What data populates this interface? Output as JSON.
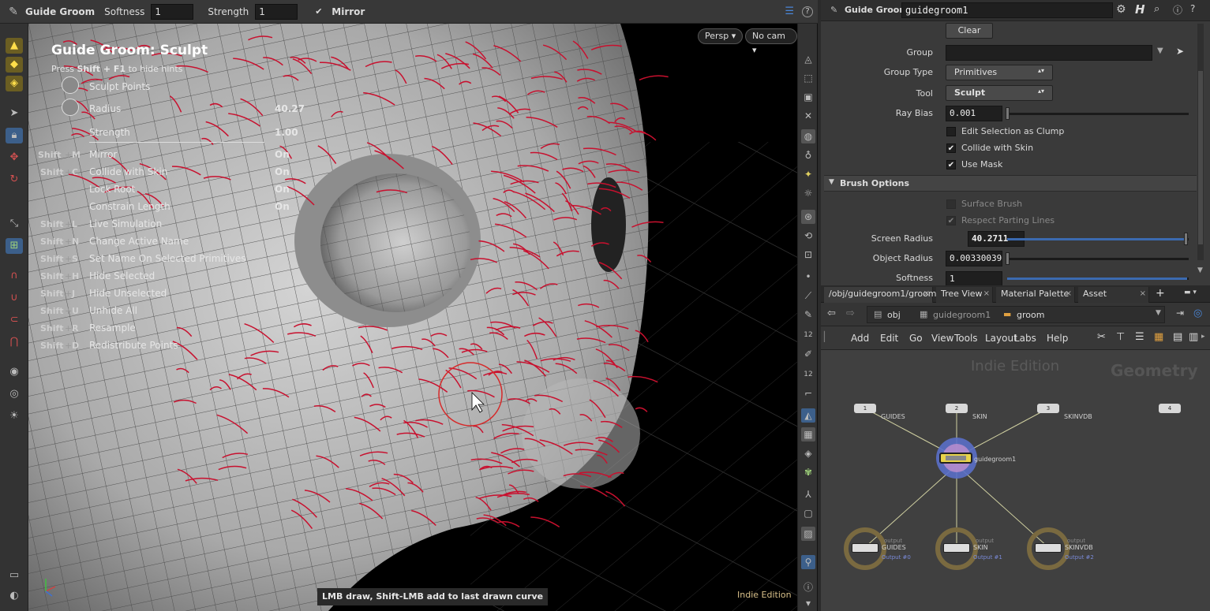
{
  "viewport_toolbar": {
    "tool_name": "Guide Groom",
    "softness_label": "Softness",
    "softness_value": "1",
    "strength_label": "Strength",
    "strength_value": "1",
    "mirror_label": "Mirror"
  },
  "viewport": {
    "hud_title": "Guide Groom: Sculpt",
    "hint_prefix": "Press ",
    "hint_keys": "Shift + F1",
    "hint_suffix": " to hide hints",
    "camera_persp": "Persp",
    "camera_nocam": "No cam",
    "status_message": "LMB draw, Shift-LMB add to last drawn curve",
    "edition_badge": "Indie Edition",
    "hud_top": [
      {
        "label": "Sculpt Points",
        "value": ""
      },
      {
        "label": "Radius",
        "value": "40.27"
      },
      {
        "label": "Strength",
        "value": "1.00"
      }
    ],
    "hotkeys": [
      {
        "mod": "Shift",
        "key": "M",
        "label": "Mirror",
        "value": "On"
      },
      {
        "mod": "Shift",
        "key": "C",
        "label": "Collide with Skin",
        "value": "On"
      },
      {
        "mod": "",
        "key": "",
        "label": "Lock Root",
        "value": "On"
      },
      {
        "mod": "",
        "key": "",
        "label": "Constrain Length",
        "value": "On"
      },
      {
        "mod": "Shift",
        "key": "L",
        "label": "Live Simulation",
        "value": ""
      },
      {
        "mod": "Shift",
        "key": "N",
        "label": "Change Active Name",
        "value": ""
      },
      {
        "mod": "Shift",
        "key": "S",
        "label": "Set Name On Selected Primitives",
        "value": ""
      },
      {
        "mod": "Shift",
        "key": "H",
        "label": "Hide Selected",
        "value": ""
      },
      {
        "mod": "Shift",
        "key": "J",
        "label": "Hide Unselected",
        "value": ""
      },
      {
        "mod": "Shift",
        "key": "U",
        "label": "Unhide All",
        "value": ""
      },
      {
        "mod": "Shift",
        "key": "R",
        "label": "Resample",
        "value": ""
      },
      {
        "mod": "Shift",
        "key": "D",
        "label": "Redistribute Points",
        "value": ""
      }
    ]
  },
  "params": {
    "node_type": "Guide Groom",
    "node_name": "guidegroom1",
    "clear_label": "Clear",
    "group_label": "Group",
    "group_value": "",
    "group_type_label": "Group Type",
    "group_type_value": "Primitives",
    "tool_label": "Tool",
    "tool_value": "Sculpt",
    "ray_bias_label": "Ray Bias",
    "ray_bias_value": "0.001",
    "edit_selection_label": "Edit Selection as Clump",
    "collide_label": "Collide with Skin",
    "use_mask_label": "Use Mask",
    "brush_section": "Brush Options",
    "surface_brush_label": "Surface Brush",
    "respect_parting_label": "Respect Parting Lines",
    "screen_radius_label": "Screen Radius",
    "screen_radius_value": "40.2711",
    "object_radius_label": "Object Radius",
    "object_radius_value": "0.00330039",
    "softness_label": "Softness",
    "softness_value": "1"
  },
  "network": {
    "tabs": [
      "/obj/guidegroom1/groom",
      "Tree View",
      "Material Palette",
      "Asset Browser"
    ],
    "path": [
      "obj",
      "guidegroom1",
      "groom"
    ],
    "menu": [
      "Add",
      "Edit",
      "Go",
      "View",
      "Tools",
      "Layout",
      "Labs",
      "Help"
    ],
    "watermark_edition": "Indie Edition",
    "watermark_context": "Geometry",
    "inputs": [
      {
        "num": "1",
        "label": "GUIDES"
      },
      {
        "num": "2",
        "label": "SKIN"
      },
      {
        "num": "3",
        "label": "SKINVDB"
      },
      {
        "num": "4",
        "label": ""
      }
    ],
    "main_node": "guidegroom1",
    "outputs": [
      {
        "tag": "output",
        "label": "GUIDES",
        "sub": "Output #0"
      },
      {
        "tag": "output",
        "label": "SKIN",
        "sub": "Output #1"
      },
      {
        "tag": "output",
        "label": "SKINVDB",
        "sub": "Output #2"
      }
    ]
  },
  "colors": {
    "accent_blue": "#3b6ab0",
    "curve_red": "#c8102e",
    "node_yellow": "#e8d34a"
  }
}
